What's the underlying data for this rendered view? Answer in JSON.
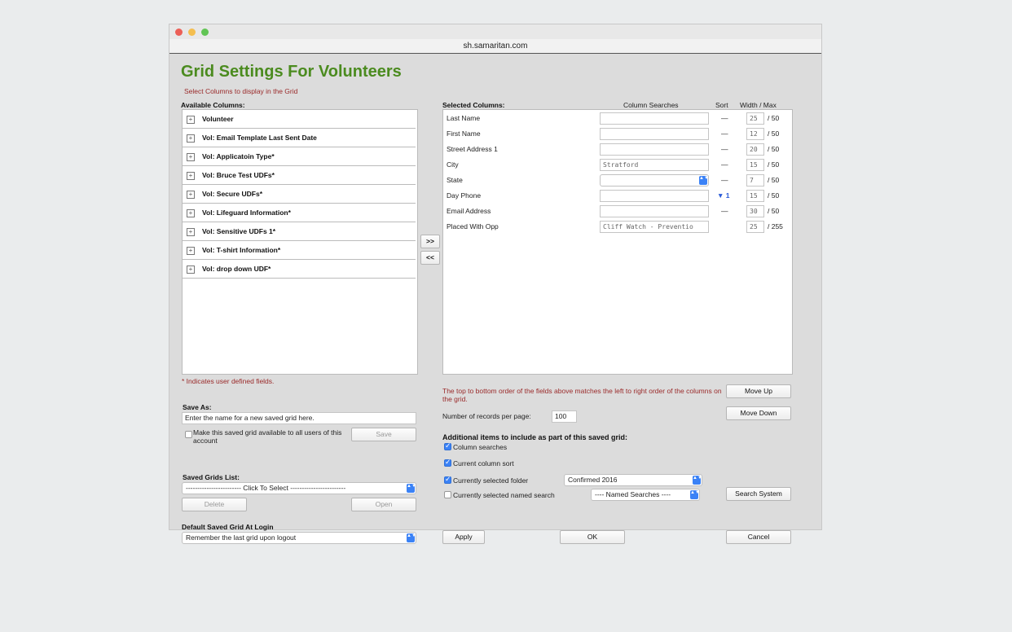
{
  "browser": {
    "url": "sh.samaritan.com",
    "colors": {
      "close": "#ec5f57",
      "minimize": "#f4be4f",
      "maximize": "#61c454"
    }
  },
  "page": {
    "title": "Grid Settings For Volunteers",
    "subtitle": "Select Columns to display in the Grid",
    "available_label": "Available Columns:",
    "selected_label": "Selected Columns:",
    "col_searches_header": "Column Searches",
    "sort_header": "Sort",
    "width_header": "Width / Max",
    "add_button": ">>",
    "remove_button": "<<",
    "udf_note": "* Indicates user defined fields.",
    "order_note": "The top to bottom order of the fields above matches the left to right order of the columns on the grid."
  },
  "available_columns": [
    {
      "label": "Volunteer"
    },
    {
      "label": "Vol: Email Template Last Sent Date"
    },
    {
      "label": "Vol: Applicatoin Type*"
    },
    {
      "label": "Vol: Bruce Test UDFs*"
    },
    {
      "label": "Vol: Secure UDFs*"
    },
    {
      "label": "Vol: Lifeguard Information*"
    },
    {
      "label": "Vol: Sensitive UDFs 1*"
    },
    {
      "label": "Vol: T-shirt Information*"
    },
    {
      "label": "Vol: drop down UDF*"
    }
  ],
  "selected_columns": [
    {
      "name": "Last Name",
      "search": "",
      "sort": "—",
      "width": "25",
      "max": "/ 50"
    },
    {
      "name": "First Name",
      "search": "",
      "sort": "—",
      "width": "12",
      "max": "/ 50"
    },
    {
      "name": "Street Address 1",
      "search": "",
      "sort": "—",
      "width": "20",
      "max": "/ 50"
    },
    {
      "name": "City",
      "search": "Stratford",
      "sort": "—",
      "width": "15",
      "max": "/ 50"
    },
    {
      "name": "State",
      "search": "",
      "sort": "—",
      "width": "7",
      "max": "/ 50"
    },
    {
      "name": "Day Phone",
      "search": "",
      "sort": "▼ 1",
      "width": "15",
      "max": "/ 50"
    },
    {
      "name": "Email Address",
      "search": "",
      "sort": "—",
      "width": "30",
      "max": "/ 50"
    },
    {
      "name": "Placed With Opp",
      "search": "Cliff Watch - Preventio",
      "sort": "",
      "width": "25",
      "max": "/ 255"
    }
  ],
  "order": {
    "move_up": "Move Up",
    "move_down": "Move Down"
  },
  "records": {
    "label": "Number of records per page:",
    "value": "100"
  },
  "save": {
    "label": "Save As:",
    "placeholder": "Enter the name for a new saved grid here.",
    "share_label": "Make this saved grid available to all users of this account",
    "save_button": "Save"
  },
  "saved_grids": {
    "label": "Saved Grids List:",
    "select_value": "------------------------ Click To Select ------------------------",
    "delete_button": "Delete",
    "open_button": "Open"
  },
  "default_grid": {
    "label": "Default Saved Grid At Login",
    "value": "Remember the last grid upon logout"
  },
  "additional": {
    "label": "Additional items to include as part of this saved grid:",
    "column_searches": "Column searches",
    "column_sort": "Current column sort",
    "selected_folder": "Currently selected folder",
    "folder_value": "Confirmed 2016",
    "named_search": "Currently selected named search",
    "named_value": "---- Named Searches ----",
    "search_system": "Search System"
  },
  "footer": {
    "apply": "Apply",
    "ok": "OK",
    "cancel": "Cancel"
  }
}
